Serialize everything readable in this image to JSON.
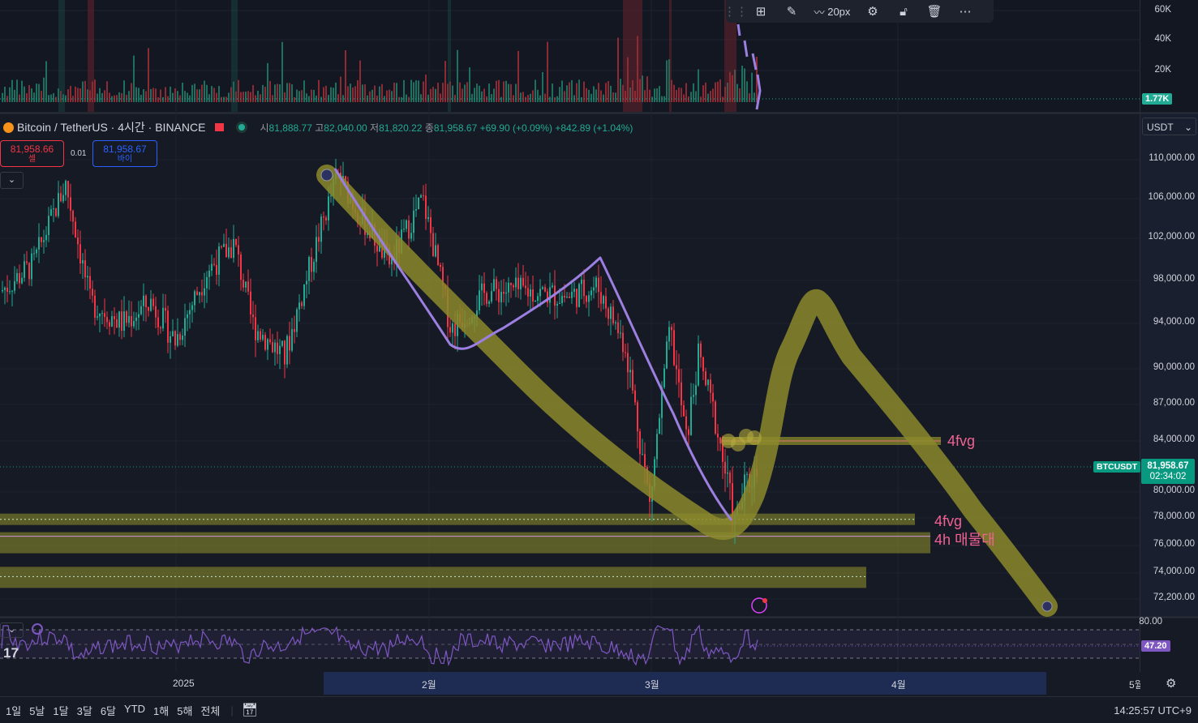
{
  "toolbar": {
    "width_label": "20px"
  },
  "volume": {
    "ticks": [
      "60K",
      "40K",
      "20K"
    ],
    "last_value": "1.77K"
  },
  "legend": {
    "symbol": "Bitcoin / TetherUS · 4시간 · BINANCE",
    "open_label": "시",
    "open_value": "81,888.77",
    "high_label": "고",
    "high_value": "82,040.00",
    "low_label": "저",
    "low_value": "81,820.22",
    "close_label": "종",
    "close_value": "81,958.67",
    "change": "+69.90 (+0.09%)",
    "change2": "+842.89 (+1.04%)"
  },
  "trade": {
    "sell_price": "81,958.66",
    "sell_label": "셀",
    "spread": "0.01",
    "buy_price": "81,958.67",
    "buy_label": "바이"
  },
  "currency": "USDT",
  "price_axis": {
    "ticks": [
      "110,000.00",
      "106,000.00",
      "102,000.00",
      "98,000.00",
      "94,000.00",
      "90,000.00",
      "87,000.00",
      "84,000.00",
      "80,000.00",
      "78,000.00",
      "76,000.00",
      "74,000.00",
      "72,200.00"
    ]
  },
  "last_price": {
    "symbol_tag": "BTCUSDT",
    "price": "81,958.67",
    "countdown": "02:34:02"
  },
  "annotations": {
    "fvg_top": "4fvg",
    "fvg_bottom": "4fvg",
    "supply": "4h 매물대"
  },
  "rsi": {
    "level_top": "80.00",
    "value": "47.20"
  },
  "time_axis": {
    "labels": [
      "2025",
      "2월",
      "3월",
      "4월",
      "5월"
    ]
  },
  "bottom": {
    "timeframes": [
      "1일",
      "5날",
      "1달",
      "3달",
      "6달",
      "YTD",
      "1해",
      "5해",
      "전체"
    ],
    "clock": "14:25:57 UTC+9"
  },
  "colors": {
    "up": "#22ab94",
    "down": "#f23645",
    "drawing_olive": "#8b8a2c",
    "drawing_purple": "#9c7fe0",
    "fvg_label": "#f06292"
  },
  "chart_data": {
    "type": "candlestick",
    "timeframe": "4시간",
    "x": [
      "2025",
      "2월",
      "3월",
      "4월",
      "5월"
    ],
    "price_range": [
      72200,
      110000
    ],
    "last": {
      "open": 81888.77,
      "high": 82040.0,
      "low": 81820.22,
      "close": 81958.67
    },
    "closes_approx": [
      {
        "label": "start",
        "value": 97000
      },
      {
        "label": "peak_late_jan",
        "value": 106000
      },
      {
        "label": "mid",
        "value": 92000
      },
      {
        "label": "peak_jan_end",
        "value": 108500
      },
      {
        "label": "feb_low",
        "value": 91500
      },
      {
        "label": "feb_range",
        "value": 98000
      },
      {
        "label": "late_feb_low",
        "value": 78300
      },
      {
        "label": "early_mar_high",
        "value": 95000
      },
      {
        "label": "mar_low",
        "value": 76600
      },
      {
        "label": "now",
        "value": 81958.67
      }
    ],
    "horizontal_zones": [
      {
        "label": "4fvg",
        "value": 84000
      },
      {
        "label": "4fvg",
        "value": 77900
      },
      {
        "label": "4h 매물대",
        "value": 76200
      },
      {
        "label": "",
        "value": 73700
      }
    ],
    "volume_last": "1.77K",
    "rsi_last": 47.2
  }
}
